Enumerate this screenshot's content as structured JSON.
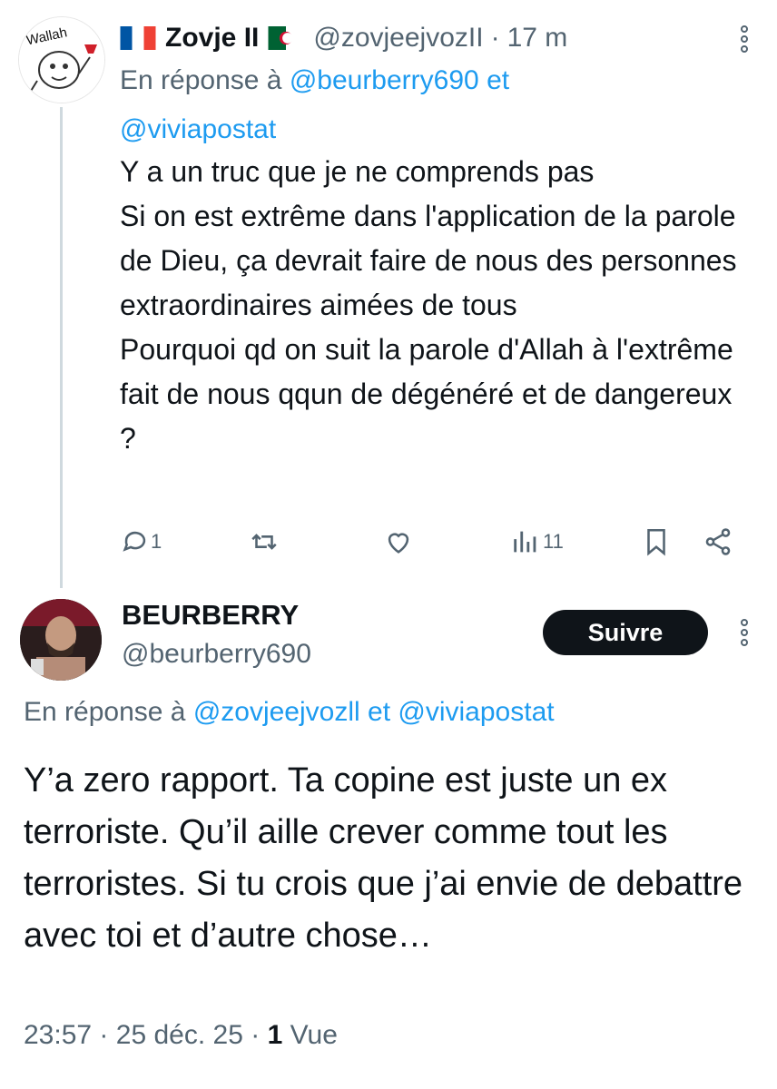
{
  "tweet1": {
    "avatar_text": "Wallah",
    "name": "Zovje II",
    "handle": "@zovjeejvozII",
    "separator": "·",
    "time": "17 m",
    "reply_prefix": "En réponse à",
    "reply_user1": "@beurberry690",
    "reply_and": "et",
    "reply_user2": "@viviapostat",
    "text": "Y a un truc que je ne comprends pas\nSi on est extrême dans l'application de la parole de Dieu, ça devrait faire de nous des personnes extraordinaires aimées de tous\nPourquoi qd on suit la parole d'Allah à l'extrême fait de nous qqun de dégénéré et de dangereux ?",
    "reply_count": "1",
    "view_count": "11",
    "icons": [
      "more-dots-icon",
      "reply-icon",
      "retweet-icon",
      "like-icon",
      "views-icon",
      "bookmark-icon",
      "share-icon"
    ]
  },
  "tweet2": {
    "name": "BEURBERRY",
    "handle": "@beurberry690",
    "follow_label": "Suivre",
    "reply_prefix": "En réponse à",
    "reply_user1": "@zovjeejvozll",
    "reply_and": "et",
    "reply_user2": "@viviapostat",
    "text": "Y’a zero rapport. Ta copine est juste un ex terroriste. Qu’il aille crever comme tout les terroristes. Si tu crois que j’ai envie de debattre avec toi et d’autre chose…",
    "time": "23:57",
    "sep1": "·",
    "date": "25 déc. 25",
    "sep2": "·",
    "views": "1",
    "views_label": "Vue"
  },
  "colors": {
    "link": "#1d9bf0",
    "muted": "#536471",
    "text": "#0f1419",
    "thread_line": "#cfd9de",
    "button": "#0f1419"
  }
}
